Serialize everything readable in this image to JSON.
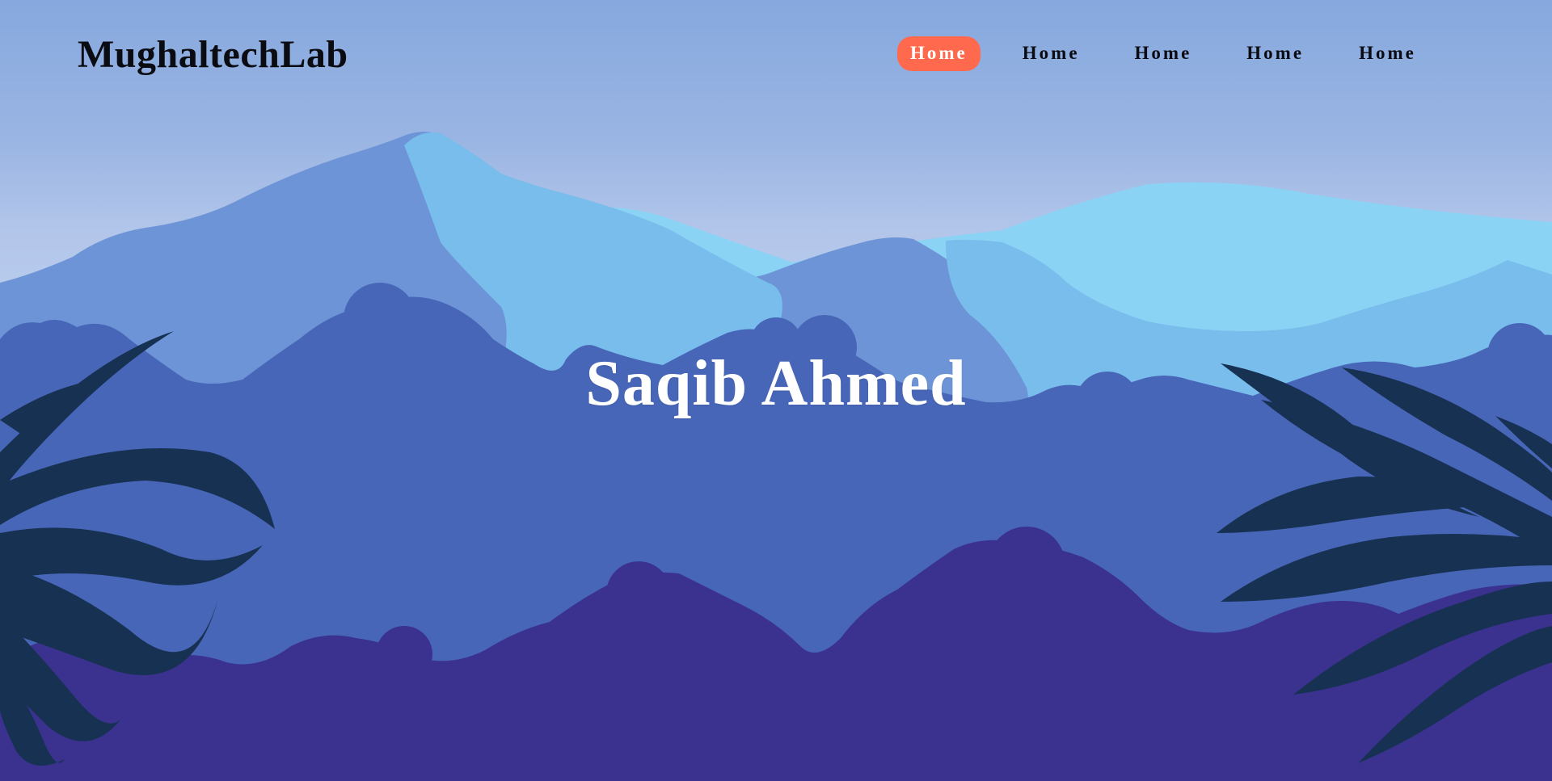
{
  "header": {
    "logo": "MughaltechLab",
    "nav": [
      {
        "label": "Home",
        "active": true
      },
      {
        "label": "Home",
        "active": false
      },
      {
        "label": "Home",
        "active": false
      },
      {
        "label": "Home",
        "active": false
      },
      {
        "label": "Home",
        "active": false
      }
    ]
  },
  "hero": {
    "title": "Saqib Ahmed"
  },
  "colors": {
    "sky_top": "#86a8de",
    "sky_bottom": "#b8cdee",
    "mountain_far": "#6d94d6",
    "mountain_light": "#78bdeb",
    "mountain_pale": "#8ad3f5",
    "foliage_mid": "#4866b8",
    "foliage_front": "#3b3290",
    "palm_leaves": "#173152",
    "active_nav_bg": "#ff6a4e",
    "active_nav_text": "#ffffff",
    "title_text": "#ffffff"
  }
}
